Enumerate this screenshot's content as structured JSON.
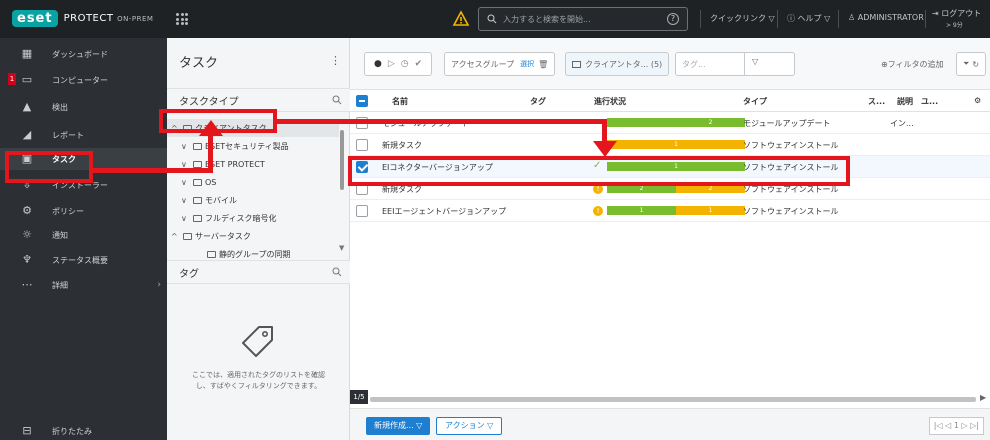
{
  "topbar": {
    "brand": "eset",
    "product": "PROTECT",
    "product_suffix": "ON-PREM",
    "search_placeholder": "入力すると検索を開始...",
    "quick_links": "クイックリンク ▽",
    "help": "ヘルプ ▽",
    "user": "ADMINISTRATOR",
    "logout": "ログアウト",
    "logout_sub": "> 9分"
  },
  "nav": {
    "items": [
      {
        "icon": "dashboard-icon",
        "glyph": "▦",
        "label": "ダッシュボード"
      },
      {
        "icon": "computer-icon",
        "glyph": "▭",
        "label": "コンピューター"
      },
      {
        "icon": "warning-icon",
        "glyph": "▲",
        "label": "検出"
      },
      {
        "icon": "report-icon",
        "glyph": "◢",
        "label": "レポート"
      },
      {
        "icon": "task-icon",
        "glyph": "▣",
        "label": "タスク"
      },
      {
        "icon": "installer-icon",
        "glyph": "⇩",
        "label": "インストーラー"
      },
      {
        "icon": "policy-icon",
        "glyph": "⚙",
        "label": "ポリシー"
      },
      {
        "icon": "notification-icon",
        "glyph": "☼",
        "label": "通知"
      },
      {
        "icon": "status-icon",
        "glyph": "♆",
        "label": "ステータス概要"
      },
      {
        "icon": "more-icon",
        "glyph": "⋯",
        "label": "詳細"
      }
    ],
    "collapse": "折りたたみ",
    "badge": "1"
  },
  "panel": {
    "title": "タスク",
    "task_types_header": "タスクタイプ",
    "tree": [
      {
        "label": "クライアントタスク",
        "level": 0,
        "caret": "^",
        "selected": true
      },
      {
        "label": "ESETセキュリティ製品",
        "level": 1,
        "caret": "v",
        "selected": false
      },
      {
        "label": "ESET PROTECT",
        "level": 1,
        "caret": "v",
        "selected": false
      },
      {
        "label": "OS",
        "level": 1,
        "caret": "v",
        "selected": false
      },
      {
        "label": "モバイル",
        "level": 1,
        "caret": "v",
        "selected": false
      },
      {
        "label": "フルディスク暗号化",
        "level": 1,
        "caret": "v",
        "selected": false
      },
      {
        "label": "サーバータスク",
        "level": 0,
        "caret": "^",
        "selected": false
      },
      {
        "label": "静的グループの同期",
        "level": 2,
        "caret": "",
        "selected": false
      }
    ],
    "tags_header": "タグ",
    "tags_empty": "ここでは、適用されたタグのリストを確認し、すばやくフィルタリングできます。"
  },
  "toolbar": {
    "access_group": "アクセスグループ",
    "select": "選択",
    "client_task_filter": "クライアントタ... (5)",
    "tag_placeholder": "タグ...",
    "add_filter": "フィルタの追加"
  },
  "table": {
    "columns": [
      "名前",
      "タグ",
      "進行状況",
      "タイプ",
      "ス...",
      "説明",
      "ユ..."
    ],
    "rows": [
      {
        "name": "モジュールアップデート",
        "type": "モジュールアップデート",
        "extra": "イン...",
        "checked": false,
        "status_icon": "",
        "segments": [
          {
            "c": "g",
            "w": 0.5,
            "t": ""
          },
          {
            "c": "g",
            "w": 0.5,
            "t": "2"
          }
        ]
      },
      {
        "name": "新規タスク",
        "type": "ソフトウェアインストール",
        "extra": "",
        "checked": false,
        "status_icon": "",
        "segments": [
          {
            "c": "y",
            "w": 1,
            "t": "1"
          }
        ]
      },
      {
        "name": "EIコネクターバージョンアップ",
        "type": "ソフトウェアインストール",
        "extra": "",
        "checked": true,
        "status_icon": "check",
        "segments": [
          {
            "c": "g",
            "w": 1,
            "t": "1"
          }
        ]
      },
      {
        "name": "新規タスク",
        "type": "ソフトウェアインストール",
        "extra": "",
        "checked": false,
        "status_icon": "warn",
        "segments": [
          {
            "c": "g",
            "w": 0.5,
            "t": "2"
          },
          {
            "c": "y",
            "w": 0.5,
            "t": "2"
          }
        ]
      },
      {
        "name": "EEIエージェントバージョンアップ",
        "type": "ソフトウェアインストール",
        "extra": "",
        "checked": false,
        "status_icon": "warn",
        "segments": [
          {
            "c": "g",
            "w": 0.5,
            "t": "1"
          },
          {
            "c": "y",
            "w": 0.5,
            "t": "1"
          }
        ]
      }
    ]
  },
  "footer": {
    "new_button": "新規作成... ▽",
    "actions_button": "アクション ▽",
    "page_indicator": "1/5",
    "pager": "|◁ ◁ 1 ▷ ▷|"
  },
  "colors": {
    "annotation_red": "#e3161d",
    "progress_green": "#79bd2f",
    "progress_yellow": "#f5b301",
    "accent_blue": "#1e7fd0"
  }
}
